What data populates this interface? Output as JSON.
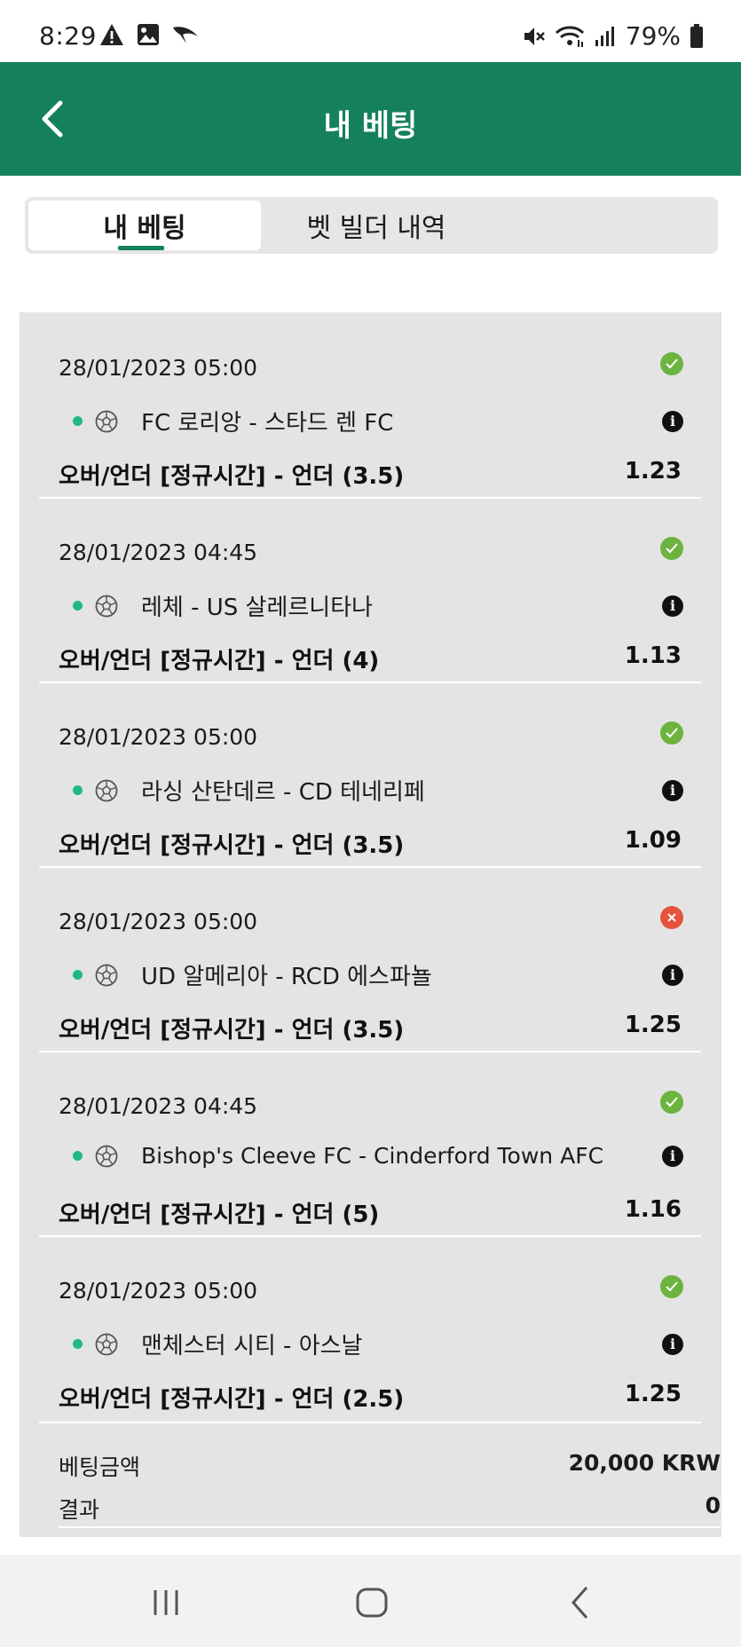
{
  "status_bar": {
    "time": "8:29",
    "battery": "79%",
    "left_icons": [
      "warning-icon",
      "image-icon",
      "bird-app-icon"
    ],
    "right_icons": [
      "mute-icon",
      "wifi-icon",
      "signal-icon",
      "battery-icon"
    ]
  },
  "header": {
    "title": "내 베팅",
    "back_icon": "chevron-left-icon",
    "color": "#15805d"
  },
  "tabs": [
    {
      "label": "내 베팅",
      "active": true
    },
    {
      "label": "벳 빌더 내역",
      "active": false
    }
  ],
  "bets": [
    {
      "date": "28/01/2023 05:00",
      "status": "won",
      "match": "FC 로리앙 - 스타드 렌 FC",
      "market": "오버/언더 [정규시간] - 언더 (3.5)",
      "odds": "1.23"
    },
    {
      "date": "28/01/2023 04:45",
      "status": "won",
      "match": "레체 - US 살레르니타나",
      "market": "오버/언더 [정규시간] - 언더 (4)",
      "odds": "1.13"
    },
    {
      "date": "28/01/2023 05:00",
      "status": "won",
      "match": "라싱 산탄데르 - CD 테네리페",
      "market": "오버/언더 [정규시간] - 언더 (3.5)",
      "odds": "1.09"
    },
    {
      "date": "28/01/2023 05:00",
      "status": "lost",
      "match": "UD 알메리아 - RCD 에스파뇰",
      "market": "오버/언더 [정규시간] - 언더 (3.5)",
      "odds": "1.25"
    },
    {
      "date": "28/01/2023 04:45",
      "status": "won",
      "match": "Bishop's Cleeve FC - Cinderford Town AFC",
      "market": "오버/언더 [정규시간] - 언더 (5)",
      "odds": "1.16"
    },
    {
      "date": "28/01/2023 05:00",
      "status": "won",
      "match": "맨체스터 시티 - 아스날",
      "market": "오버/언더 [정규시간] - 언더 (2.5)",
      "odds": "1.25"
    }
  ],
  "summary": {
    "stake_label": "베팅금액",
    "stake_value": "20,000 KRW",
    "result_label": "결과",
    "result_value": "0"
  },
  "nav": [
    "recent-apps-icon",
    "home-icon",
    "back-icon"
  ],
  "colors": {
    "won": "#6cb33f",
    "lost": "#e5533d",
    "live_dot": "#1fb981",
    "panel": "#e4e4e4"
  }
}
